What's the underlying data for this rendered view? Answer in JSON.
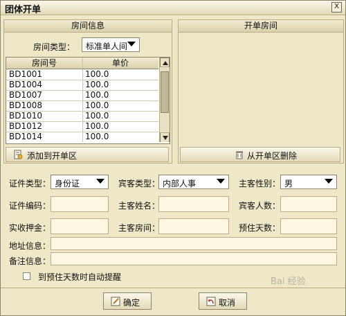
{
  "window": {
    "title": "团体开单",
    "close_label": "X"
  },
  "room_info": {
    "header": "房间信息",
    "room_type_label": "房间类型：",
    "room_type_value": "标准单人间",
    "table": {
      "columns": [
        "房间号",
        "单价"
      ],
      "rows": [
        [
          "BD1001",
          "100.0"
        ],
        [
          "BD1004",
          "100.0"
        ],
        [
          "BD1007",
          "100.0"
        ],
        [
          "BD1008",
          "100.0"
        ],
        [
          "BD1010",
          "100.0"
        ],
        [
          "BD1012",
          "100.0"
        ],
        [
          "BD1014",
          "100.0"
        ]
      ]
    },
    "add_button": "添加到开单区"
  },
  "open_rooms": {
    "header": "开单房间",
    "remove_button": "从开单区删除"
  },
  "form": {
    "id_type_label": "证件类型：",
    "id_type_value": "身份证",
    "guest_type_label": "宾客类型：",
    "guest_type_value": "内部人事",
    "host_gender_label": "主客性别：",
    "host_gender_value": "男",
    "id_number_label": "证件编码：",
    "host_name_label": "主客姓名：",
    "guest_count_label": "宾客人数：",
    "deposit_label": "实收押金：",
    "host_room_label": "主客房间：",
    "days_label": "预住天数：",
    "address_label": "地址信息：",
    "remark_label": "备注信息：",
    "reminder_label": "到预住天数时自动提醒"
  },
  "footer": {
    "confirm": "确定",
    "cancel": "取消"
  },
  "watermark": "Bai 经验"
}
